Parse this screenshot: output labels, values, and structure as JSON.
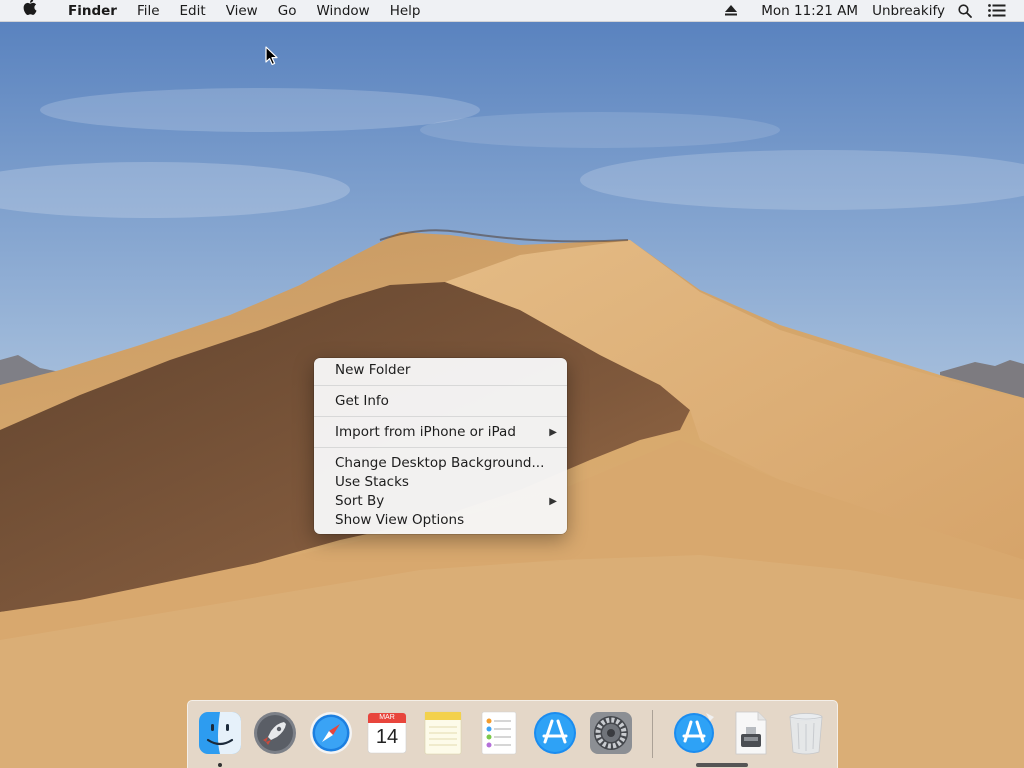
{
  "menubar": {
    "app_name": "Finder",
    "menus": [
      "File",
      "Edit",
      "View",
      "Go",
      "Window",
      "Help"
    ],
    "clock": "Mon 11:21 AM",
    "user": "Unbreakify",
    "icons": [
      "apple-icon",
      "eject-icon",
      "spotlight-search-icon",
      "notification-center-icon"
    ]
  },
  "context_menu": {
    "items": [
      "New Folder",
      "Get Info",
      "Import from iPhone or iPad",
      "Change Desktop Background...",
      "Use Stacks",
      "Sort By",
      "Show View Options"
    ],
    "submenu_arrow": "▶"
  },
  "dock": {
    "apps": [
      "finder-icon",
      "launchpad-icon",
      "safari-icon",
      "calendar-icon",
      "notes-icon",
      "reminders-icon",
      "app-store-icon",
      "system-preferences-icon"
    ],
    "others": [
      "app-store-download-icon",
      "installer-disk-icon",
      "trash-icon"
    ],
    "calendar": {
      "month": "MAR",
      "day": "14"
    }
  },
  "colors": {
    "sky_top": "#5a83bf",
    "sky_bottom": "#dfe9f3",
    "dune_light": "#d9ab72",
    "dune_shadow": "#6e4c34",
    "menu_bg": "#f6f6f6"
  }
}
